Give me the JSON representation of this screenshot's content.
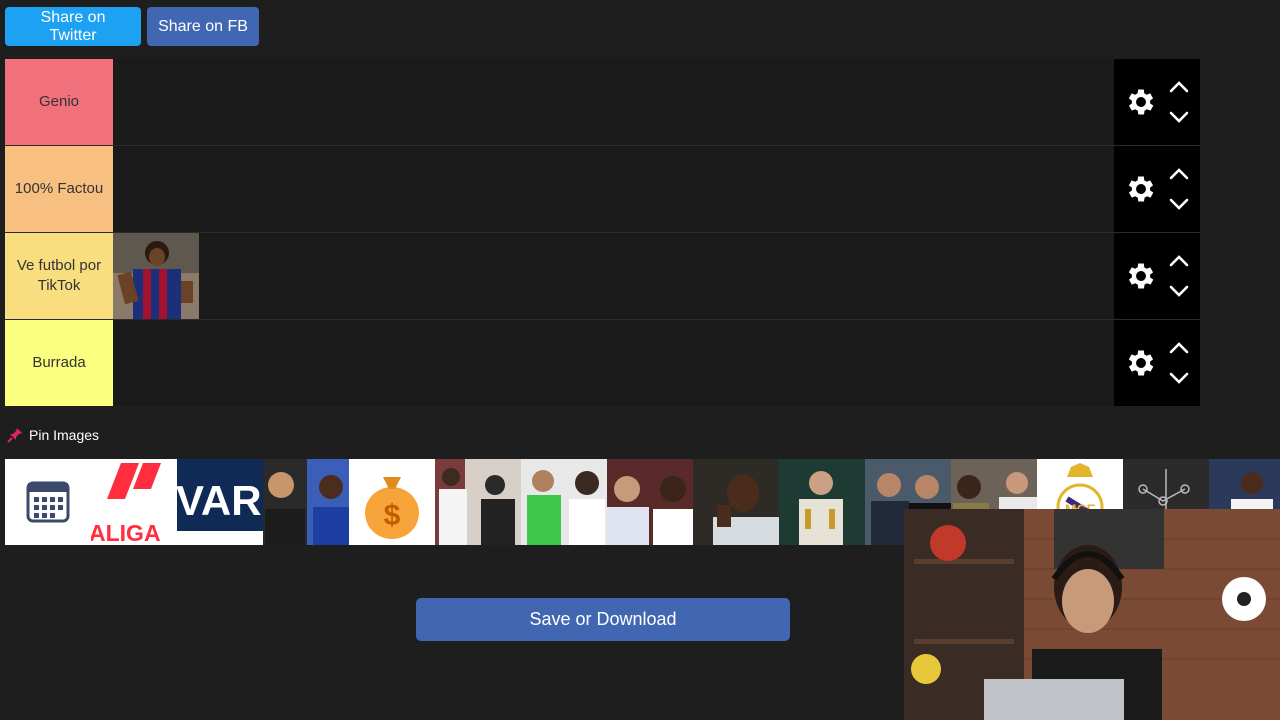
{
  "share": {
    "twitter_label": "Share on Twitter",
    "fb_label": "Share on FB"
  },
  "tiers": [
    {
      "label": "Genio",
      "color": "#f0717b"
    },
    {
      "label": "100% Factou",
      "color": "#f7bf80"
    },
    {
      "label": "Ve futbol por TikTok",
      "color": "#f8de7f"
    },
    {
      "label": "Burrada",
      "color": "#fbff7f"
    }
  ],
  "pin": {
    "label": "Pin Images"
  },
  "save": {
    "label": "Save or Download"
  },
  "pool_text": {
    "laliga": "ALIGA",
    "var": "VAR"
  },
  "colors": {
    "twitter": "#1da1f2",
    "facebook": "#4267b2",
    "tier_background": "#1a1a1a",
    "page_background": "#1e1e1e"
  }
}
